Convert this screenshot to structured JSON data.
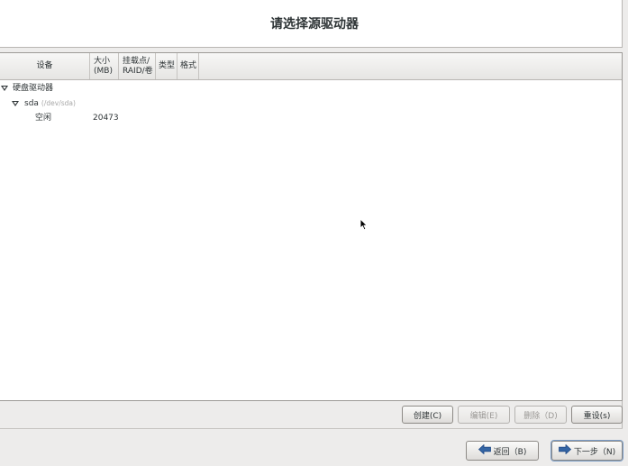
{
  "header": {
    "title": "请选择源驱动器"
  },
  "table": {
    "columns": [
      "设备",
      "大小\n(MB)",
      "挂载点/\nRAID/卷",
      "类型",
      "格式"
    ],
    "rows": [
      {
        "device": "硬盘驱动器",
        "level": 0,
        "expanded": true
      },
      {
        "device": "sda",
        "path": "(/dev/sda)",
        "level": 1,
        "expanded": true
      },
      {
        "device": "空闲",
        "size": "20473",
        "level": 2
      }
    ]
  },
  "actions": {
    "create": "创建(C)",
    "edit": "编辑(E)",
    "delete": "删除（D)",
    "reset": "重设(s)"
  },
  "nav": {
    "back": "返回（B)",
    "next": "下一步（N)"
  },
  "icons": {
    "expander": "triangle-down-icon",
    "back": "arrow-left-icon",
    "next": "arrow-right-icon",
    "cursor": "mouse-pointer-icon"
  },
  "colors": {
    "nav_arrow": "#3465a4"
  }
}
